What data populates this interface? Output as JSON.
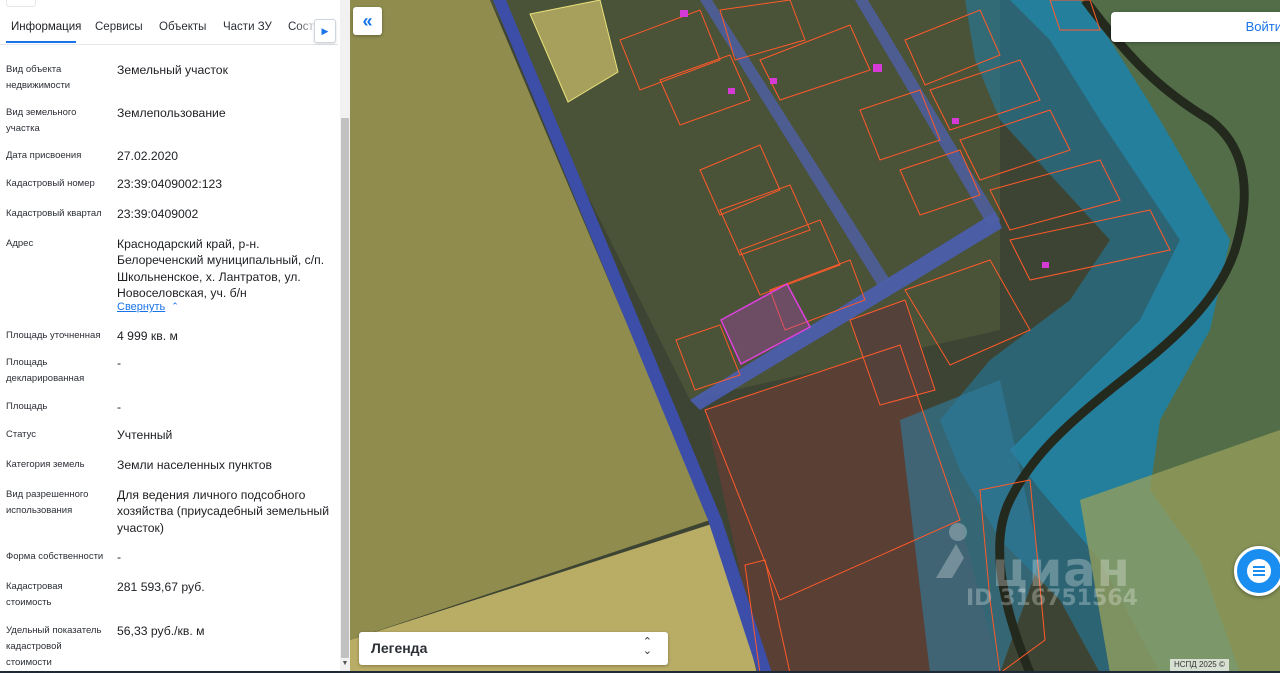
{
  "tabs": [
    {
      "label": "Информация"
    },
    {
      "label": "Сервисы"
    },
    {
      "label": "Объекты"
    },
    {
      "label": "Части ЗУ"
    },
    {
      "label": "Состав"
    }
  ],
  "info_rows": [
    {
      "label": "Вид объекта недвижимости",
      "value": "Земельный участок"
    },
    {
      "label": "Вид земельного участка",
      "value": "Землепользование"
    },
    {
      "label": "Дата присвоения",
      "value": "27.02.2020"
    },
    {
      "label": "Кадастровый номер",
      "value": "23:39:0409002:123"
    },
    {
      "label": "Кадастровый квартал",
      "value": "23:39:0409002"
    },
    {
      "label": "Адрес",
      "value": "Краснодарский край, р-н. Белореченский муниципальный, с/п. Школьненское, х. Лантратов, ул. Новоселовская, уч. б/н"
    },
    {
      "label": "Площадь уточненная",
      "value": "4 999 кв. м"
    },
    {
      "label": "Площадь декларированная",
      "value": "-"
    },
    {
      "label": "Площадь",
      "value": "-"
    },
    {
      "label": "Статус",
      "value": "Учтенный"
    },
    {
      "label": "Категория земель",
      "value": "Земли населенных пунктов"
    },
    {
      "label": "Вид разрешенного использования",
      "value": "Для ведения личного подсобного хозяйства (приусадебный земельный участок)"
    },
    {
      "label": "Форма собственности",
      "value": "-"
    },
    {
      "label": "Кадастровая стоимость",
      "value": "281 593,67 руб."
    },
    {
      "label": "Удельный показатель кадастровой стоимости",
      "value": "56,33 руб./кв. м"
    }
  ],
  "address_collapse_label": "Свернуть",
  "map": {
    "login_label": "Войти",
    "legend_label": "Легенда",
    "watermark_brand": "циан",
    "watermark_id": "ID 316751564",
    "copyright": "НСПД 2025 ©"
  },
  "colors": {
    "accent": "#1a73e8",
    "selected_parcel": "#e040e0",
    "parcel_outline": "#ff5a2a",
    "field_yellow": "#b8b06a",
    "water_zone": "#1fa3d8"
  },
  "icons": {
    "tab_next": "chevron-right-icon",
    "panel_collapse": "double-chevron-left-icon",
    "legend_toggle": "chevron-up-down-icon",
    "chat": "chat-icon"
  }
}
